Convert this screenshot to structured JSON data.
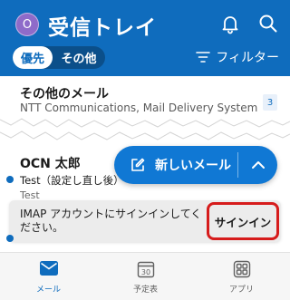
{
  "header": {
    "avatar_initial": "O",
    "title": "受信トレイ",
    "seg_focused": "優先",
    "seg_other": "その他",
    "filter_label": "フィルター"
  },
  "other_inbox": {
    "title": "その他のメール",
    "subtitle": "NTT Communications, Mail Delivery System",
    "count": "3"
  },
  "email": {
    "sender": "OCN 太郎",
    "subject": "Test（設定し直し後）",
    "preview": "Test"
  },
  "compose": {
    "label": "新しいメール"
  },
  "snackbar": {
    "message": "IMAP アカウントにサインインしてください。",
    "action": "サインイン"
  },
  "tabs": [
    {
      "label": "メール",
      "icon": "mail-icon"
    },
    {
      "label": "予定表",
      "icon": "calendar-icon",
      "day": "30"
    },
    {
      "label": "アプリ",
      "icon": "apps-icon"
    }
  ],
  "colors": {
    "accent": "#0f6cbd",
    "compose": "#1078d4",
    "highlight": "#d61c1c"
  }
}
